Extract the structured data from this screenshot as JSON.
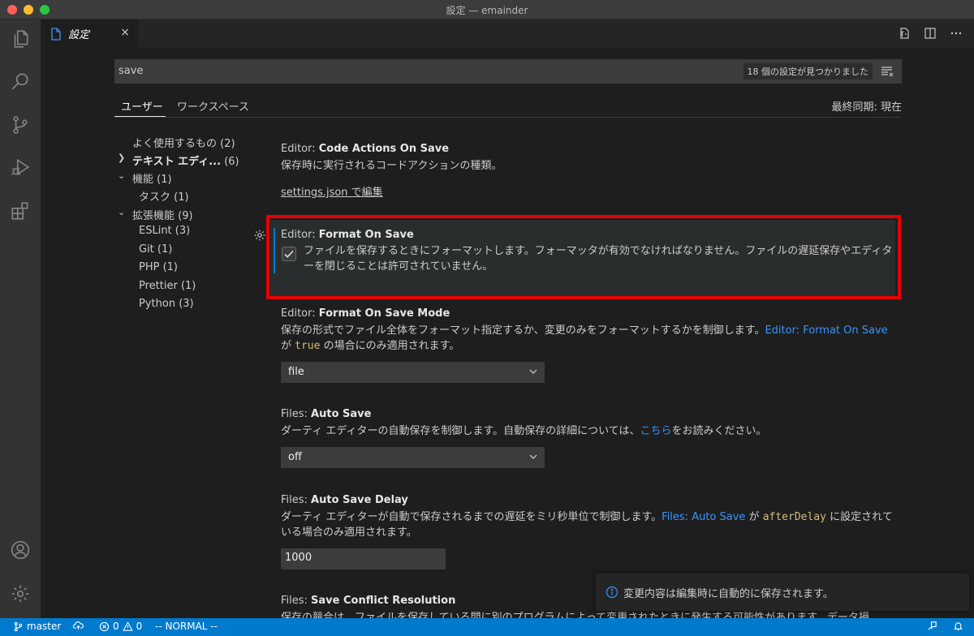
{
  "window": {
    "title": "設定 — emainder"
  },
  "tab": {
    "label": "設定",
    "close": "×"
  },
  "search": {
    "value": "save",
    "result_count": "18 個の設定が見つかりました"
  },
  "scope_tabs": {
    "user": "ユーザー",
    "workspace": "ワークスペース",
    "last_sync": "最終同期: 現在"
  },
  "toc": {
    "items": [
      {
        "label": "よく使用するもの (2)"
      },
      {
        "label": "テキスト エディ...",
        "count": "(6)"
      },
      {
        "label": "機能 (1)"
      },
      {
        "label": "タスク (1)"
      },
      {
        "label": "拡張機能 (9)"
      },
      {
        "label": "ESLint (3)"
      },
      {
        "label": "Git (1)"
      },
      {
        "label": "PHP (1)"
      },
      {
        "label": "Prettier (1)"
      },
      {
        "label": "Python (3)"
      }
    ]
  },
  "settings": {
    "code_actions": {
      "category": "Editor: ",
      "name": "Code Actions On Save",
      "description": "保存時に実行されるコードアクションの種類。",
      "link": "settings.json で編集"
    },
    "format_on_save": {
      "category": "Editor: ",
      "name": "Format On Save",
      "description": "ファイルを保存するときにフォーマットします。フォーマッタが有効でなければなりません。ファイルの遅延保存やエディターを閉じることは許可されていません。",
      "checked": true
    },
    "format_on_save_mode": {
      "category": "Editor: ",
      "name": "Format On Save Mode",
      "desc_part1": "保存の形式でファイル全体をフォーマット指定するか、変更のみをフォーマットするかを制御します。",
      "desc_link": "Editor: Format On Save",
      "desc_part2": "が ",
      "desc_code": "true",
      "desc_part3": " の場合にのみ適用されます。",
      "value": "file"
    },
    "auto_save": {
      "category": "Files: ",
      "name": "Auto Save",
      "desc_part1": "ダーティ エディターの自動保存を制御します。自動保存の詳細については、",
      "desc_link": "こちら",
      "desc_part2": "をお読みください。",
      "value": "off"
    },
    "auto_save_delay": {
      "category": "Files: ",
      "name": "Auto Save Delay",
      "desc_part1": "ダーティ エディターが自動で保存されるまでの遅延をミリ秒単位で制御します。",
      "desc_link": "Files: Auto Save",
      "desc_part2": " が ",
      "desc_code": "afterDelay",
      "desc_part3": " に設定されている場合のみ適用されます。",
      "value": "1000"
    },
    "save_conflict": {
      "category": "Files: ",
      "name": "Save Conflict Resolution",
      "description": "保存の競合は、ファイルを保存している間に別のプログラムによって変更されたときに発生する可能性があります。データ損"
    }
  },
  "notification": {
    "text": "変更内容は編集時に自動的に保存されます。"
  },
  "statusbar": {
    "branch": "master",
    "errors": "0",
    "warnings": "0",
    "mode": "-- NORMAL --"
  },
  "colors": {
    "accent": "#007acc",
    "highlight": "#e80000",
    "link": "#3794ff"
  },
  "icons": [
    "files-icon",
    "search-icon",
    "source-control-icon",
    "run-debug-icon",
    "extensions-icon",
    "account-icon",
    "manage-gear-icon"
  ]
}
